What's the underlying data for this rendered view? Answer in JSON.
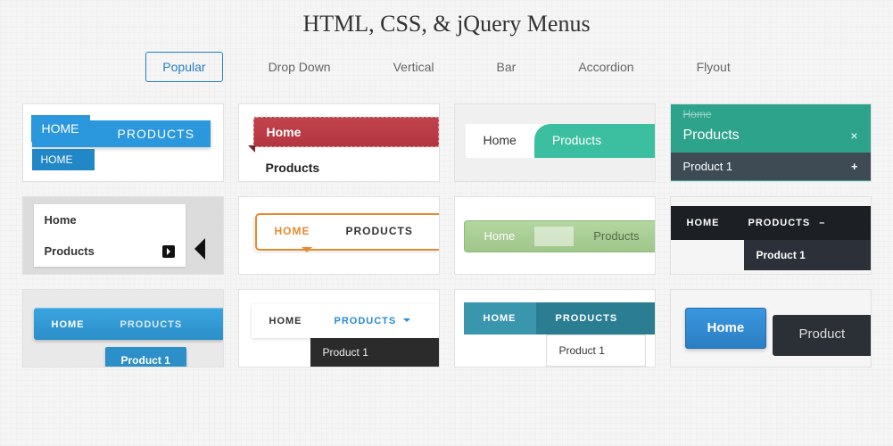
{
  "title": "HTML, CSS, & jQuery Menus",
  "tabs": [
    "Popular",
    "Drop Down",
    "Vertical",
    "Bar",
    "Accordion",
    "Flyout"
  ],
  "active_tab": 0,
  "cards": {
    "c1": {
      "home": "HOME",
      "products": "PRODUCTS",
      "sub": "HOME"
    },
    "c2": {
      "home": "Home",
      "products": "Products"
    },
    "c3": {
      "home": "Home",
      "products": "Products"
    },
    "c4": {
      "top": "Home",
      "products": "Products",
      "close": "×",
      "sub": "Product 1",
      "plus": "+"
    },
    "c5": {
      "home": "Home",
      "products": "Products"
    },
    "c6": {
      "home": "HOME",
      "products": "PRODUCTS"
    },
    "c7": {
      "home": "Home",
      "products": "Products"
    },
    "c8": {
      "home": "HOME",
      "products": "PRODUCTS",
      "minus": "–",
      "sub": "Product 1"
    },
    "c9": {
      "home": "HOME",
      "products": "PRODUCTS",
      "drop": "Product 1"
    },
    "c10": {
      "home": "HOME",
      "products": "PRODUCTS",
      "sub": "Product 1"
    },
    "c11": {
      "home": "HOME",
      "products": "PRODUCTS",
      "drop": "Product 1"
    },
    "c12": {
      "home": "Home",
      "products": "Product"
    }
  }
}
